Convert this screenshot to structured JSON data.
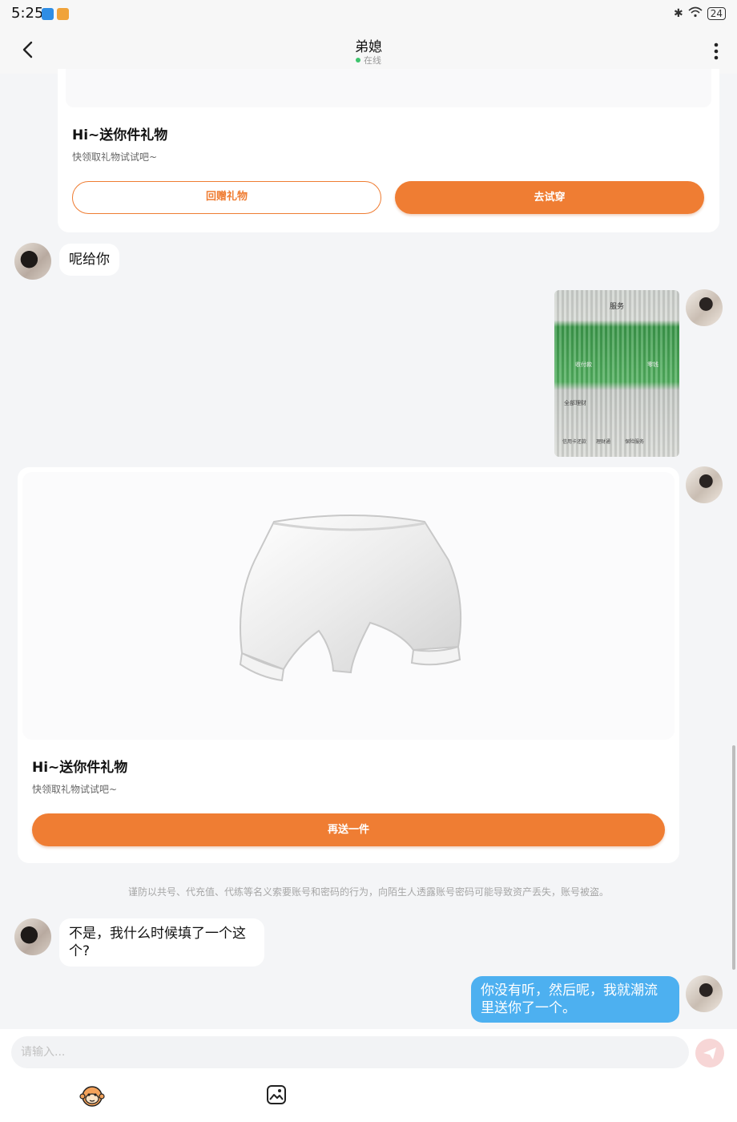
{
  "status_bar": {
    "time": "5:25",
    "battery": "24"
  },
  "header": {
    "contact_name": "弟媳",
    "contact_status": "在线"
  },
  "messages": {
    "gift_card_1": {
      "title": "Hi~送你件礼物",
      "subtitle": "快领取礼物试试吧~",
      "return_gift_label": "回赠礼物",
      "try_on_label": "去试穿"
    },
    "text_1": "呢给你",
    "screenshot": {
      "title": "服务",
      "labels": [
        "收付款",
        "零钱",
        "全部理财",
        "信用卡还款",
        "理财通",
        "保险服务"
      ]
    },
    "gift_card_2": {
      "title": "Hi~送你件礼物",
      "subtitle": "快领取礼物试试吧~",
      "send_again_label": "再送一件"
    },
    "notice": "谨防以共号、代充值、代练等名义索要账号和密码的行为，向陌生人透露账号密码可能导致资产丢失，账号被盗。",
    "text_2": "不是，我什么时候填了一个这个?",
    "text_3": "你没有听，然后呢，我就潮流里送你了一个。"
  },
  "input": {
    "placeholder": "请输入..."
  },
  "icons": {
    "back": "back-arrow-icon",
    "more": "more-vertical-icon",
    "send": "send-icon",
    "sticker": "monkey-sticker-icon",
    "image": "image-icon"
  },
  "colors": {
    "accent": "#ef7d33",
    "outgoing_bubble": "#4db0f0",
    "online": "#3ec46d",
    "background": "#f4f5f7"
  }
}
